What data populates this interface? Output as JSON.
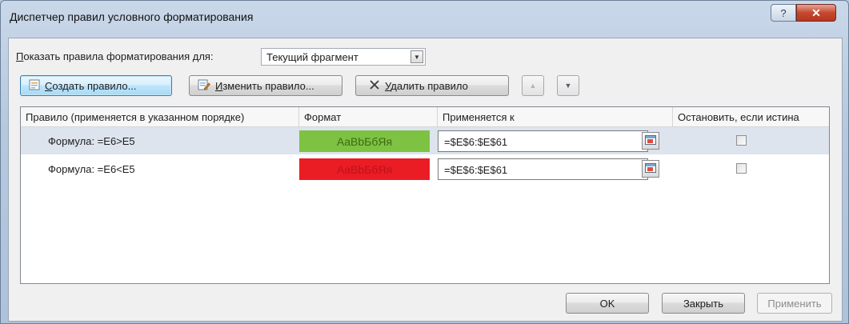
{
  "window": {
    "title": "Диспетчер правил условного форматирования",
    "help_glyph": "?",
    "close_glyph": "✕"
  },
  "show_rules": {
    "label_prefix": "П",
    "label_rest": "оказать правила форматирования для:",
    "selected": "Текущий фрагмент"
  },
  "toolbar": {
    "new_rule": {
      "accel": "С",
      "rest": "оздать правило...",
      "icon": "new-rule-icon"
    },
    "edit_rule": {
      "accel": "И",
      "rest": "зменить правило...",
      "icon": "edit-rule-icon"
    },
    "delete_rule": {
      "accel": "У",
      "rest": "далить правило",
      "icon": "delete-x-icon"
    },
    "move_up": "▲",
    "move_down": "▼"
  },
  "table": {
    "columns": [
      "Правило (применяется в указанном порядке)",
      "Формат",
      "Применяется к",
      "Остановить, если истина"
    ],
    "rows": [
      {
        "rule": "Формула: =E6>E5",
        "format_sample": "AaBbБбЯя",
        "format_bg": "#7dc242",
        "format_fg": "#3d6a12",
        "applies_to": "=$E$6:$E$61",
        "stop_if_true": false,
        "selected": true
      },
      {
        "rule": "Формула: =E6<E5",
        "format_sample": "AaBbБбЯя",
        "format_bg": "#ea1c24",
        "format_fg": "#c0121a",
        "applies_to": "=$E$6:$E$61",
        "stop_if_true": false,
        "selected": false
      }
    ]
  },
  "buttons": {
    "ok": "OK",
    "close": "Закрыть",
    "apply": "Применить"
  }
}
